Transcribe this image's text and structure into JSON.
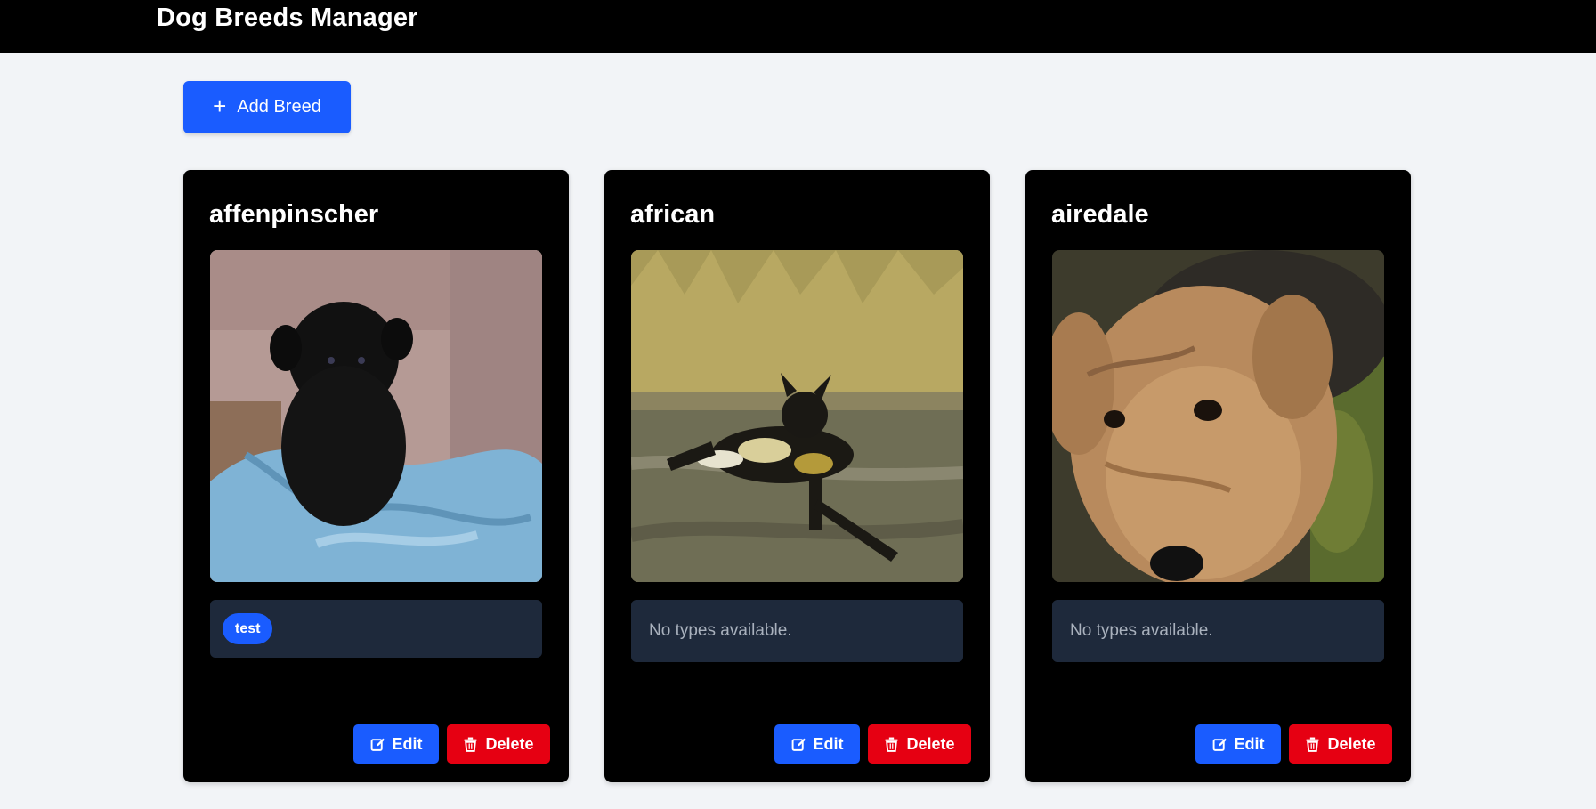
{
  "header": {
    "title": "Dog Breeds Manager"
  },
  "toolbar": {
    "add_label": "Add Breed",
    "add_icon": "plus-icon"
  },
  "colors": {
    "primary": "#1a5cff",
    "danger": "#e60012",
    "card_bg": "#000000",
    "types_bg": "#1e293b",
    "page_bg": "#f2f4f7"
  },
  "cards": [
    {
      "name": "affenpinscher",
      "types": [
        "test"
      ],
      "empty_text": "",
      "edit_label": "Edit",
      "delete_label": "Delete"
    },
    {
      "name": "african",
      "types": [],
      "empty_text": "No types available.",
      "edit_label": "Edit",
      "delete_label": "Delete"
    },
    {
      "name": "airedale",
      "types": [],
      "empty_text": "No types available.",
      "edit_label": "Edit",
      "delete_label": "Delete"
    }
  ]
}
